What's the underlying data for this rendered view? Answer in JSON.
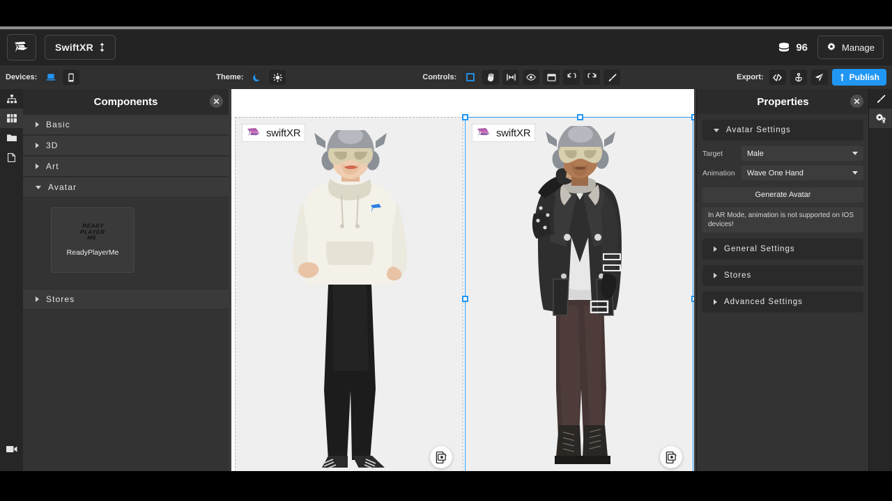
{
  "app": {
    "brand_logo": "swiftxr-flag-icon",
    "project_name": "SwiftXR",
    "project_switch_icon": "up-down-arrows-icon"
  },
  "topbar": {
    "coins_icon": "coin-stack-icon",
    "coins_value": "96",
    "manage_icon": "gear-icon",
    "manage_label": "Manage"
  },
  "toolbar": {
    "devices_label": "Devices:",
    "devices": [
      {
        "name": "device-desktop",
        "icon": "laptop-icon",
        "active": true
      },
      {
        "name": "device-mobile",
        "icon": "phone-icon",
        "active": false
      }
    ],
    "theme_label": "Theme:",
    "themes": [
      {
        "name": "theme-dark",
        "icon": "moon-icon",
        "active": true
      },
      {
        "name": "theme-light",
        "icon": "sun-icon",
        "active": false
      }
    ],
    "controls_label": "Controls:",
    "controls": [
      {
        "name": "control-select",
        "icon": "square-outline-icon",
        "active": true
      },
      {
        "name": "control-pan",
        "icon": "hand-icon",
        "active": false
      },
      {
        "name": "control-scale",
        "icon": "resize-icon",
        "active": false
      },
      {
        "name": "control-preview",
        "icon": "eye-icon",
        "active": false
      },
      {
        "name": "control-layout",
        "icon": "window-icon",
        "active": false
      },
      {
        "name": "control-undo",
        "icon": "undo-arrow-icon",
        "active": false
      },
      {
        "name": "control-redo",
        "icon": "redo-arrow-icon",
        "active": false
      },
      {
        "name": "control-brush",
        "icon": "paintbrush-icon",
        "active": false
      }
    ],
    "export_label": "Export:",
    "exports": [
      {
        "name": "export-embed-code",
        "icon": "code-brackets-icon"
      },
      {
        "name": "export-download",
        "icon": "anchor-download-icon"
      },
      {
        "name": "export-share",
        "icon": "paper-plane-icon"
      }
    ],
    "publish_icon": "upload-arrow-icon",
    "publish_label": "Publish",
    "accent": "#2196f3"
  },
  "left_rail": [
    {
      "name": "rail-scene-tree",
      "icon": "hierarchy-icon",
      "active": false
    },
    {
      "name": "rail-components",
      "icon": "grid-blocks-icon",
      "active": true
    },
    {
      "name": "rail-assets",
      "icon": "folder-icon",
      "active": false
    },
    {
      "name": "rail-pages",
      "icon": "document-icon",
      "active": false
    },
    {
      "name": "rail-record",
      "icon": "video-camera-icon",
      "active": false
    }
  ],
  "right_rail": [
    {
      "name": "rail-styles",
      "icon": "paintbrush-icon",
      "active": false
    },
    {
      "name": "rail-settings",
      "icon": "gears-icon",
      "active": true
    }
  ],
  "components_panel": {
    "title": "Components",
    "close_icon": "close-icon",
    "groups": [
      {
        "label": "Basic",
        "expanded": false
      },
      {
        "label": "3D",
        "expanded": false
      },
      {
        "label": "Art",
        "expanded": false
      },
      {
        "label": "Avatar",
        "expanded": true
      },
      {
        "label": "Stores",
        "expanded": false
      }
    ],
    "avatar_items": [
      {
        "logo_line1": "READY",
        "logo_line2": "PLAYER",
        "logo_line3": "ME",
        "caption": "ReadyPlayerMe"
      }
    ]
  },
  "properties_panel": {
    "title": "Properties",
    "close_icon": "close-icon",
    "avatar_settings": {
      "label": "Avatar Settings",
      "expanded": true,
      "target_label": "Target",
      "target_value": "Male",
      "animation_label": "Animation",
      "animation_value": "Wave One Hand",
      "generate_label": "Generate Avatar",
      "note": "In AR Mode, animation is not supported on IOS devices!"
    },
    "sections": [
      {
        "label": "General Settings",
        "expanded": false
      },
      {
        "label": "Stores",
        "expanded": false
      },
      {
        "label": "Advanced Settings",
        "expanded": false
      }
    ]
  },
  "canvas": {
    "viewports": [
      {
        "name": "viewport-female-avatar",
        "watermark": "swiftXR",
        "ar_icon": "ar-view-icon",
        "selected": false,
        "avatar": "female avatar with helmet, white hoodie, black trousers, black sneakers"
      },
      {
        "name": "viewport-male-avatar",
        "watermark": "swiftXR",
        "ar_icon": "ar-view-icon",
        "selected": true,
        "avatar": "male avatar saluting, helmet, black leather jacket, white tee, brown jeans, black boots"
      }
    ],
    "selection_toolbar": [
      {
        "name": "move-up-button",
        "icon": "arrow-up-icon"
      },
      {
        "name": "move-button",
        "icon": "move-cross-icon"
      },
      {
        "name": "duplicate-button",
        "icon": "copy-icon"
      },
      {
        "name": "delete-button",
        "icon": "trash-icon"
      }
    ]
  }
}
